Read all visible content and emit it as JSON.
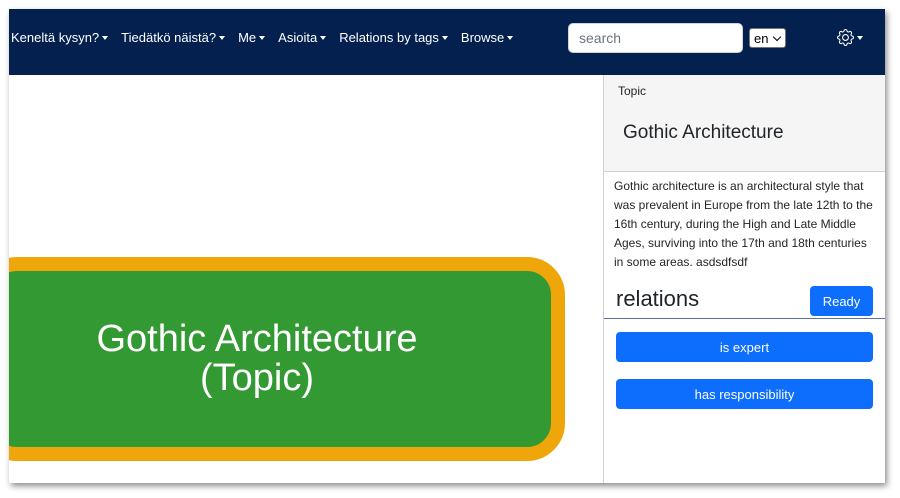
{
  "navbar": {
    "menu_items": [
      {
        "label": "Keneltä kysyn?"
      },
      {
        "label": "Tiedätkö näistä?"
      },
      {
        "label": "Me"
      },
      {
        "label": "Asioita"
      },
      {
        "label": "Relations by tags"
      },
      {
        "label": "Browse"
      }
    ],
    "search": {
      "placeholder": "search",
      "value": ""
    },
    "language": {
      "selected": "en"
    },
    "settings_icon": "gear-icon",
    "background_color": "#03204f"
  },
  "graph": {
    "node": {
      "label": "Gothic Architecture\n(Topic)",
      "fill_color": "#339933",
      "border_color": "#eea60b"
    }
  },
  "side_panel": {
    "type_label": "Topic",
    "title": "Gothic Architecture",
    "description": "Gothic architecture is an architectural style that was prevalent in Europe from the late 12th to the 16th century, during the High and Late Middle Ages, surviving into the 17th and 18th centuries in some areas. asdsdfsdf",
    "relations_heading": "relations",
    "ready_button": "Ready",
    "relation_buttons": [
      {
        "label": "is expert"
      },
      {
        "label": "has responsibility"
      }
    ],
    "accent_color": "#0d6efd"
  }
}
